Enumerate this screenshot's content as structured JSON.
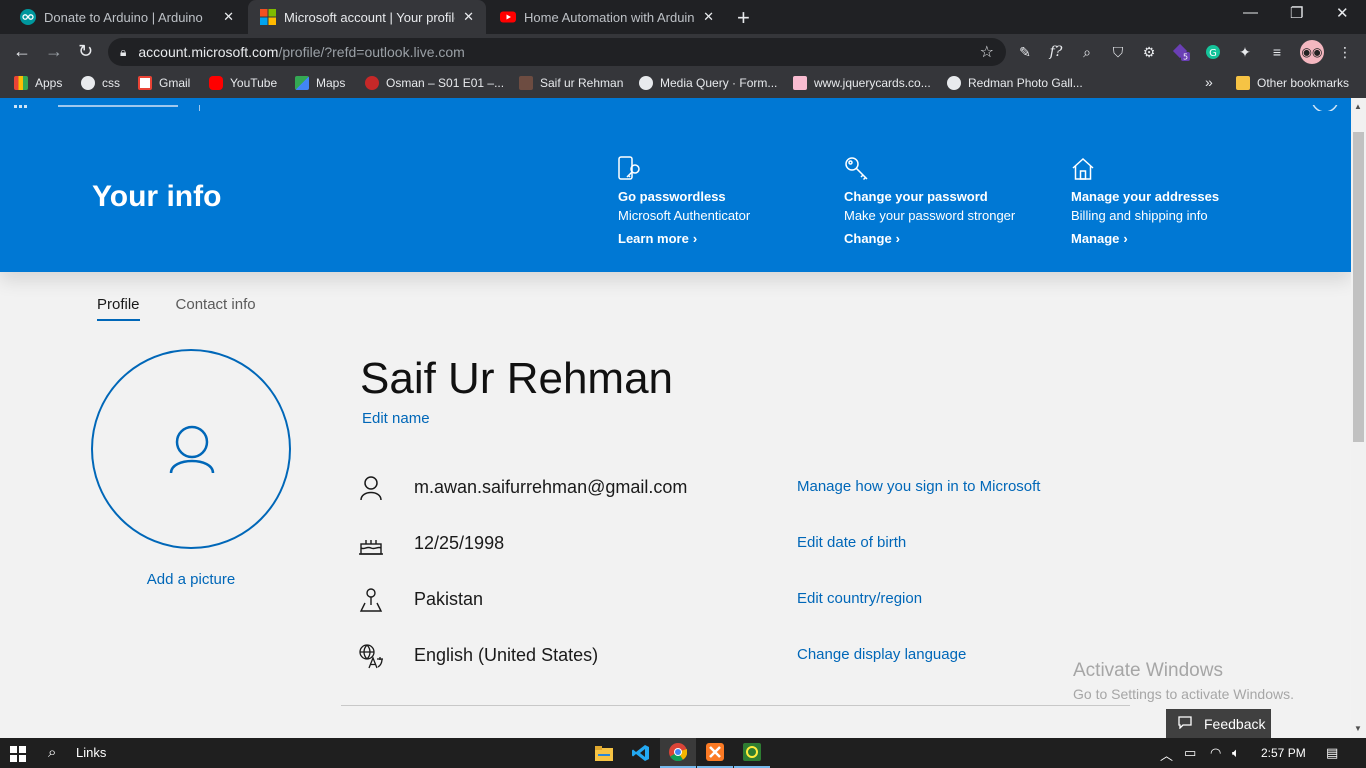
{
  "browser": {
    "tabs": [
      {
        "label": "Donate to Arduino | Arduino",
        "active": false
      },
      {
        "label": "Microsoft account | Your profile | Microsoft",
        "active": true
      },
      {
        "label": "Home Automation with Arduino and IoT",
        "active": false
      }
    ],
    "url_host": "account.microsoft.com",
    "url_path": "/profile/?refd=outlook.live.com",
    "bookmarks": [
      "Apps",
      "css",
      "Gmail",
      "YouTube",
      "Maps",
      "Osman – S01 E01 –...",
      "Saif ur Rehman",
      "Media Query · Form...",
      "www.jquerycards.co...",
      "Redman Photo Gall..."
    ],
    "bookmarks_overflow": "»",
    "other_bookmarks": "Other bookmarks",
    "extension_badge": "5"
  },
  "header": {
    "title": "Your info",
    "quick_links": [
      {
        "icon": "phone-key-icon",
        "heading": "Go passwordless",
        "sub": "Microsoft Authenticator",
        "action": "Learn more"
      },
      {
        "icon": "key-icon",
        "heading": "Change your password",
        "sub": "Make your password stronger",
        "action": "Change"
      },
      {
        "icon": "home-icon",
        "heading": "Manage your addresses",
        "sub": "Billing and shipping info",
        "action": "Manage"
      }
    ]
  },
  "profile_tabs": [
    "Profile",
    "Contact info"
  ],
  "profile": {
    "add_picture": "Add a picture",
    "name": "Saif Ur Rehman",
    "edit_name": "Edit name",
    "rows": [
      {
        "icon": "person-icon",
        "value": "m.awan.saifurrehman@gmail.com",
        "action": "Manage how you sign in to Microsoft"
      },
      {
        "icon": "birthday-cake-icon",
        "value": "12/25/1998",
        "action": "Edit date of birth"
      },
      {
        "icon": "location-pin-icon",
        "value": "Pakistan",
        "action": "Edit country/region"
      },
      {
        "icon": "language-icon",
        "value": "English (United States)",
        "action": "Change display language"
      }
    ]
  },
  "watermark": {
    "line1": "Activate Windows",
    "line2": "Go to Settings to activate Windows."
  },
  "feedback": "Feedback",
  "taskbar": {
    "search_text": "Links",
    "time": "2:57 PM"
  },
  "colors": {
    "brand": "#0078d4",
    "link": "#0067b8",
    "chrome_dark": "#202124",
    "chrome_toolbar": "#35363a"
  }
}
